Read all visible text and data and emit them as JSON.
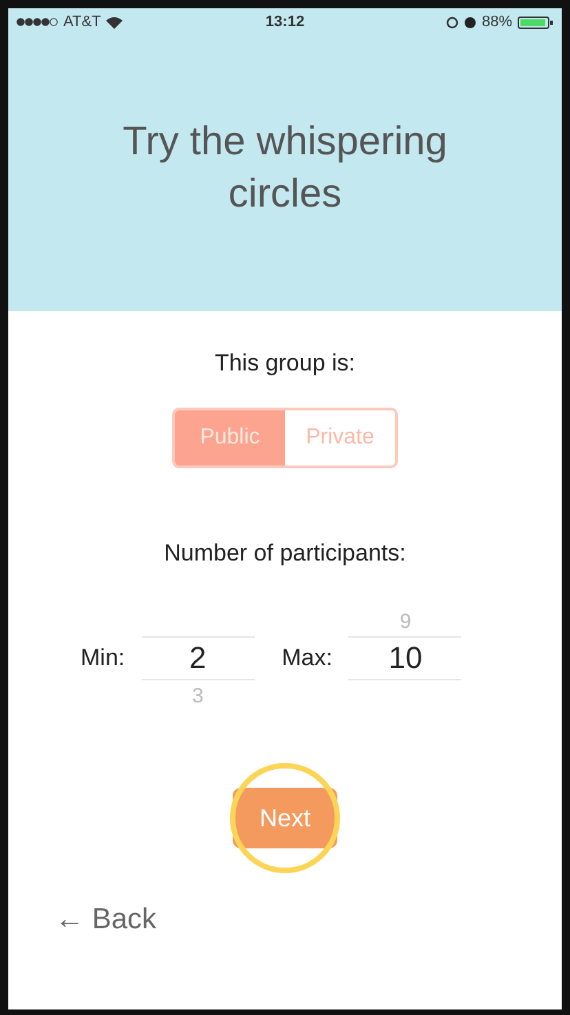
{
  "status_bar": {
    "carrier": "AT&T",
    "time": "13:12",
    "battery": "88%"
  },
  "header": {
    "title": "Try the whispering circles"
  },
  "visibility": {
    "label": "This group is:",
    "options": [
      {
        "label": "Public",
        "selected": true
      },
      {
        "label": "Private",
        "selected": false
      }
    ]
  },
  "participants": {
    "label": "Number of participants:",
    "pickers": [
      {
        "label": "Min:",
        "value": "2",
        "below": "3"
      },
      {
        "label": "Max:",
        "above": "9",
        "value": "10"
      }
    ]
  },
  "next_button": {
    "label": "Next"
  },
  "back_link": {
    "label": "← Back"
  }
}
